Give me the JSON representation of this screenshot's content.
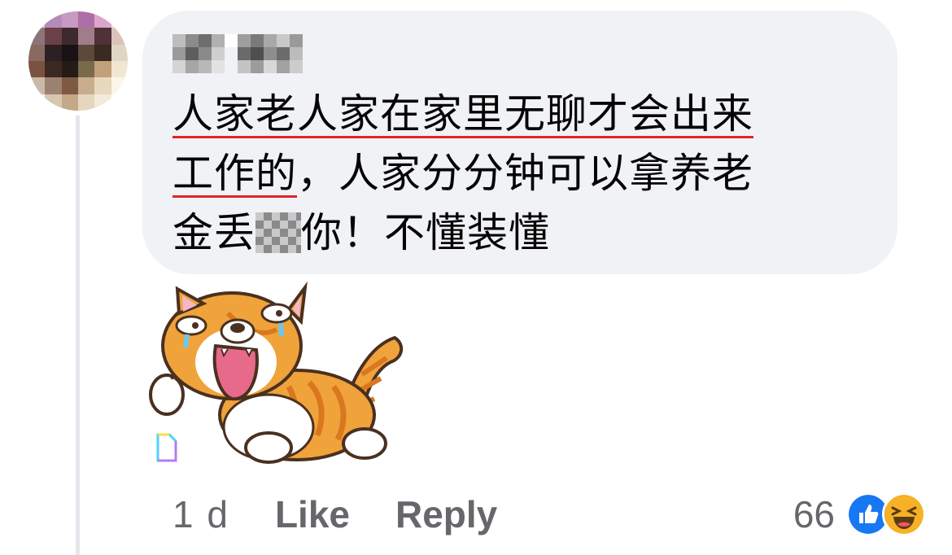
{
  "comment": {
    "text_line1": "人家老人家在家里无聊才会出来",
    "text_line2a": "工作的",
    "text_line2b": "，人家分分钟可以拿养老",
    "text_line3a": "金丢",
    "text_line3b": "你！不懂装懂"
  },
  "actions": {
    "timestamp": "1 d",
    "like_label": "Like",
    "reply_label": "Reply"
  },
  "reactions": {
    "count": "66",
    "icons": [
      "like-icon",
      "haha-icon"
    ]
  },
  "colors": {
    "bubble": "#f0f2f5",
    "text": "#050505",
    "muted": "#65676b",
    "underline": "#e0242a",
    "like_blue": "#1877f2",
    "haha_yellow": "#f7b125"
  }
}
